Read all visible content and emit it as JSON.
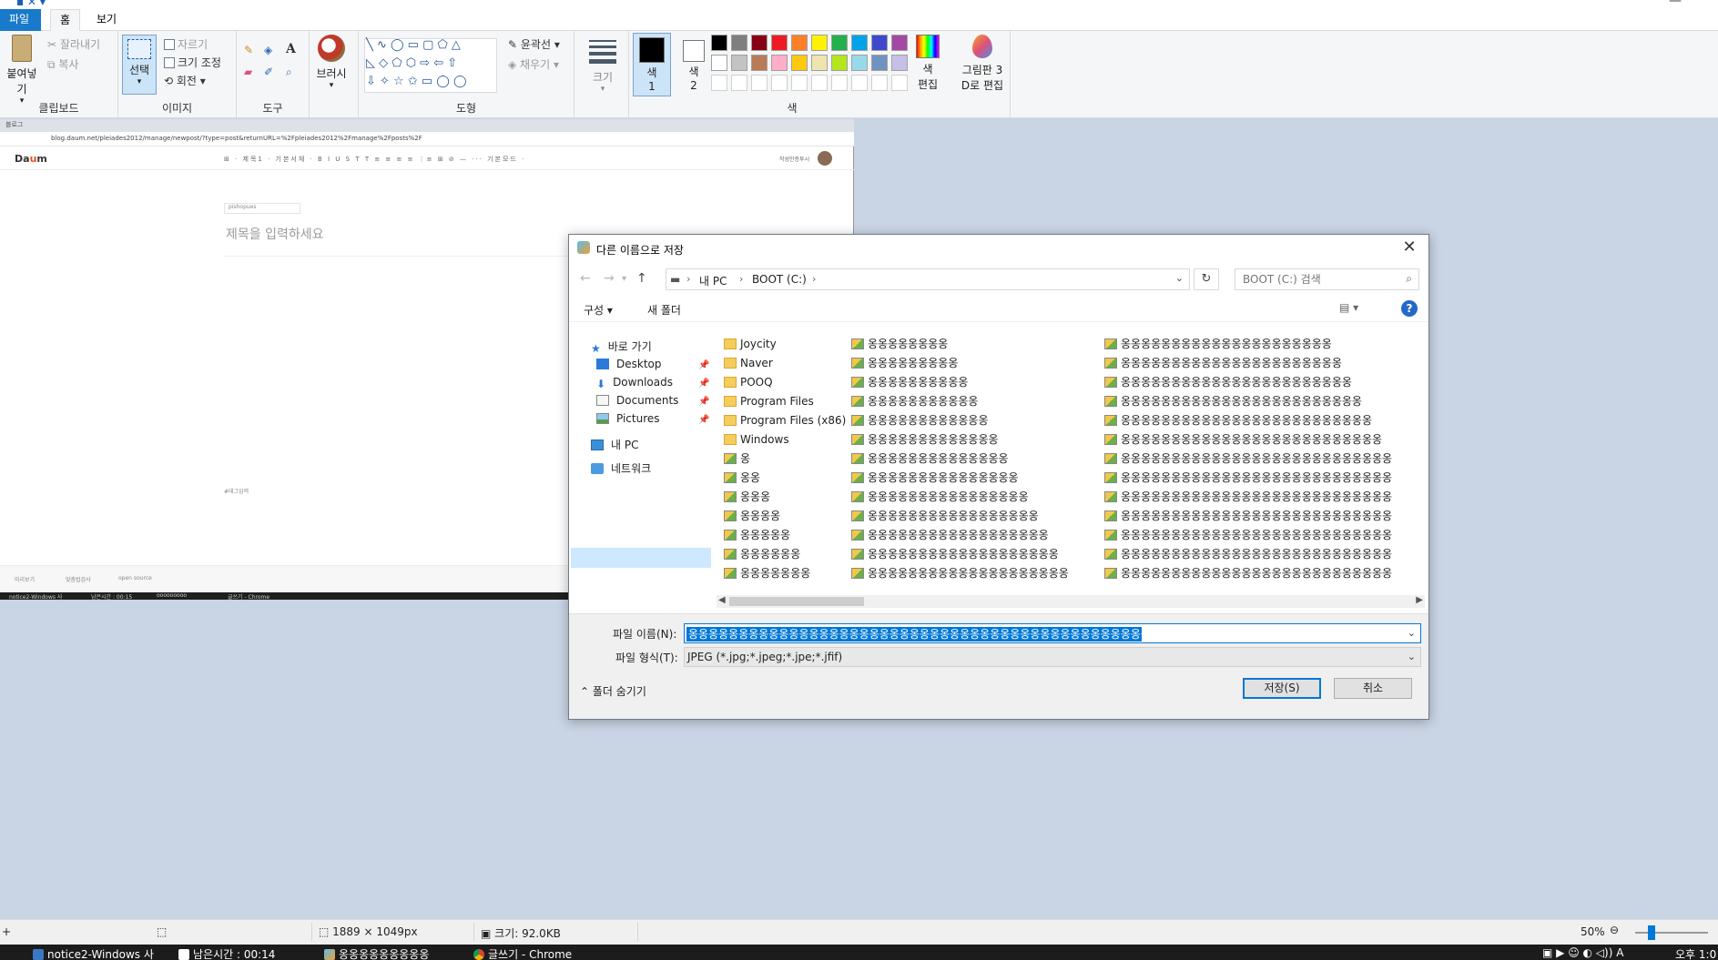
{
  "ribbon": {
    "tabs": {
      "file": "파일",
      "home": "홈",
      "view": "보기"
    },
    "clipboard": {
      "paste": "붙여넣기",
      "cut": "잘라내기",
      "copy": "복사",
      "label": "클립보드"
    },
    "image": {
      "select": "선택",
      "crop": "자르기",
      "resize": "크기 조정",
      "rotate": "회전",
      "label": "이미지"
    },
    "tools": {
      "label": "도구"
    },
    "brushes": {
      "label": "브러시"
    },
    "shapes": {
      "outline": "윤곽선",
      "fill": "채우기",
      "label": "도형"
    },
    "size": {
      "label": "크기"
    },
    "colors": {
      "color1": "색\n1",
      "color1_line1": "색",
      "color1_line2": "1",
      "color2_line1": "색",
      "color2_line2": "2",
      "edit_line1": "색",
      "edit_line2": "편집",
      "label": "색",
      "palette_row1": [
        "#000000",
        "#7f7f7f",
        "#880015",
        "#ed1c24",
        "#ff7f27",
        "#fff200",
        "#22b14c",
        "#00a2e8",
        "#3f48cc",
        "#a349a4"
      ],
      "palette_row2": [
        "#ffffff",
        "#c3c3c3",
        "#b97a57",
        "#ffaec9",
        "#ffc90e",
        "#efe4b0",
        "#b5e61d",
        "#99d9ea",
        "#7092be",
        "#c8bfe7"
      ]
    },
    "paint3d": {
      "line1": "그림판 3",
      "line2": "D로 편집"
    }
  },
  "canvas": {
    "browser_tab": "블로그",
    "url": "blog.daum.net/pleiades2012/manage/newpost/?type=post&returnURL=%2Fpleiades2012%2Fmanage%2Fposts%2F",
    "logo_a": "Da",
    "logo_b": "u",
    "logo_c": "m",
    "editor_tools": "⊞ · 제목1 · 기본서체 ·    B I U S T T    ≡ ≡ ≡ ≡   ⋮≡ ⊞ ⊘ — ···    기본모드 ·",
    "editor_right": "작성인증투시",
    "category": "pishopues",
    "title_placeholder": "제목을 입력하세요",
    "tag": "#태그입력",
    "bottom_preview": "미리보기",
    "bottom_spell": "맞춤법검사",
    "bottom_source": "open source",
    "mini_tasks": [
      "notice2-Windows 사",
      "남은시간 : 00:15",
      "ooooooooo",
      "글쓰기 - Chrome"
    ]
  },
  "dialog": {
    "title": "다른 이름으로 저장",
    "close": "✕",
    "path": [
      "내 PC",
      "BOOT (C:)"
    ],
    "search_placeholder": "BOOT (C:) 검색",
    "organize": "구성 ▾",
    "new_folder": "새 폴더",
    "view_icon": "▤ ▾",
    "help": "?",
    "nav": {
      "quick_access": "바로 가기",
      "desktop": "Desktop",
      "downloads": "Downloads",
      "documents": "Documents",
      "pictures": "Pictures",
      "my_pc": "내 PC",
      "network": "네트워크"
    },
    "files_col1": [
      {
        "name": "Joycity",
        "type": "folder"
      },
      {
        "name": "Naver",
        "type": "folder"
      },
      {
        "name": "POOQ",
        "type": "folder"
      },
      {
        "name": "Program Files",
        "type": "folder"
      },
      {
        "name": "Program Files (x86)",
        "type": "folder"
      },
      {
        "name": "Windows",
        "type": "folder"
      },
      {
        "name": "옹",
        "type": "image"
      },
      {
        "name": "옹옹",
        "type": "image"
      },
      {
        "name": "옹옹옹",
        "type": "image"
      },
      {
        "name": "옹옹옹옹",
        "type": "image"
      },
      {
        "name": "옹옹옹옹옹",
        "type": "image"
      },
      {
        "name": "옹옹옹옹옹옹",
        "type": "image"
      },
      {
        "name": "옹옹옹옹옹옹옹",
        "type": "image"
      }
    ],
    "files_col2": [
      "옹옹옹옹옹옹옹옹",
      "옹옹옹옹옹옹옹옹옹",
      "옹옹옹옹옹옹옹옹옹옹",
      "옹옹옹옹옹옹옹옹옹옹옹",
      "옹옹옹옹옹옹옹옹옹옹옹옹",
      "옹옹옹옹옹옹옹옹옹옹옹옹옹",
      "옹옹옹옹옹옹옹옹옹옹옹옹옹옹",
      "옹옹옹옹옹옹옹옹옹옹옹옹옹옹옹",
      "옹옹옹옹옹옹옹옹옹옹옹옹옹옹옹옹",
      "옹옹옹옹옹옹옹옹옹옹옹옹옹옹옹옹옹",
      "옹옹옹옹옹옹옹옹옹옹옹옹옹옹옹옹옹옹",
      "옹옹옹옹옹옹옹옹옹옹옹옹옹옹옹옹옹옹옹",
      "옹옹옹옹옹옹옹옹옹옹옹옹옹옹옹옹옹옹옹옹"
    ],
    "files_col3": [
      "옹옹옹옹옹옹옹옹옹옹옹옹옹옹옹옹옹옹옹옹옹",
      "옹옹옹옹옹옹옹옹옹옹옹옹옹옹옹옹옹옹옹옹옹옹",
      "옹옹옹옹옹옹옹옹옹옹옹옹옹옹옹옹옹옹옹옹옹옹옹",
      "옹옹옹옹옹옹옹옹옹옹옹옹옹옹옹옹옹옹옹옹옹옹옹옹",
      "옹옹옹옹옹옹옹옹옹옹옹옹옹옹옹옹옹옹옹옹옹옹옹옹옹",
      "옹옹옹옹옹옹옹옹옹옹옹옹옹옹옹옹옹옹옹옹옹옹옹옹옹옹",
      "옹옹옹옹옹옹옹옹옹옹옹옹옹옹옹옹옹옹옹옹옹옹옹옹옹옹옹",
      "옹옹옹옹옹옹옹옹옹옹옹옹옹옹옹옹옹옹옹옹옹옹옹옹옹옹옹",
      "옹옹옹옹옹옹옹옹옹옹옹옹옹옹옹옹옹옹옹옹옹옹옹옹옹옹옹",
      "옹옹옹옹옹옹옹옹옹옹옹옹옹옹옹옹옹옹옹옹옹옹옹옹옹옹옹",
      "옹옹옹옹옹옹옹옹옹옹옹옹옹옹옹옹옹옹옹옹옹옹옹옹옹옹옹",
      "옹옹옹옹옹옹옹옹옹옹옹옹옹옹옹옹옹옹옹옹옹옹옹옹옹옹옹",
      "옹옹옹옹옹옹옹옹옹옹옹옹옹옹옹옹옹옹옹옹옹옹옹옹옹옹옹"
    ],
    "filename_label": "파일 이름(N):",
    "filename_value": "옹옹옹옹옹옹옹옹옹옹옹옹옹옹옹옹옹옹옹옹옹옹옹옹옹옹옹옹옹옹옹옹옹옹옹옹옹옹옹옹옹옹옹옹옹옹옹옹옹옹옹",
    "filetype_label": "파일 형식(T):",
    "filetype_value": "JPEG (*.jpg;*.jpeg;*.jpe;*.jfif)",
    "hide_folders": "폴더 숨기기",
    "save": "저장(S)",
    "cancel": "취소"
  },
  "status": {
    "dimensions": "1889 × 1049px",
    "size": "크기: 92.0KB",
    "zoom": "50%"
  },
  "taskbar": {
    "items": [
      "notice2-Windows 사",
      "남은시간 : 00:14",
      "옹옹옹옹옹옹옹옹옹",
      "글쓰기 - Chrome"
    ],
    "clock": "오후 1:0"
  }
}
